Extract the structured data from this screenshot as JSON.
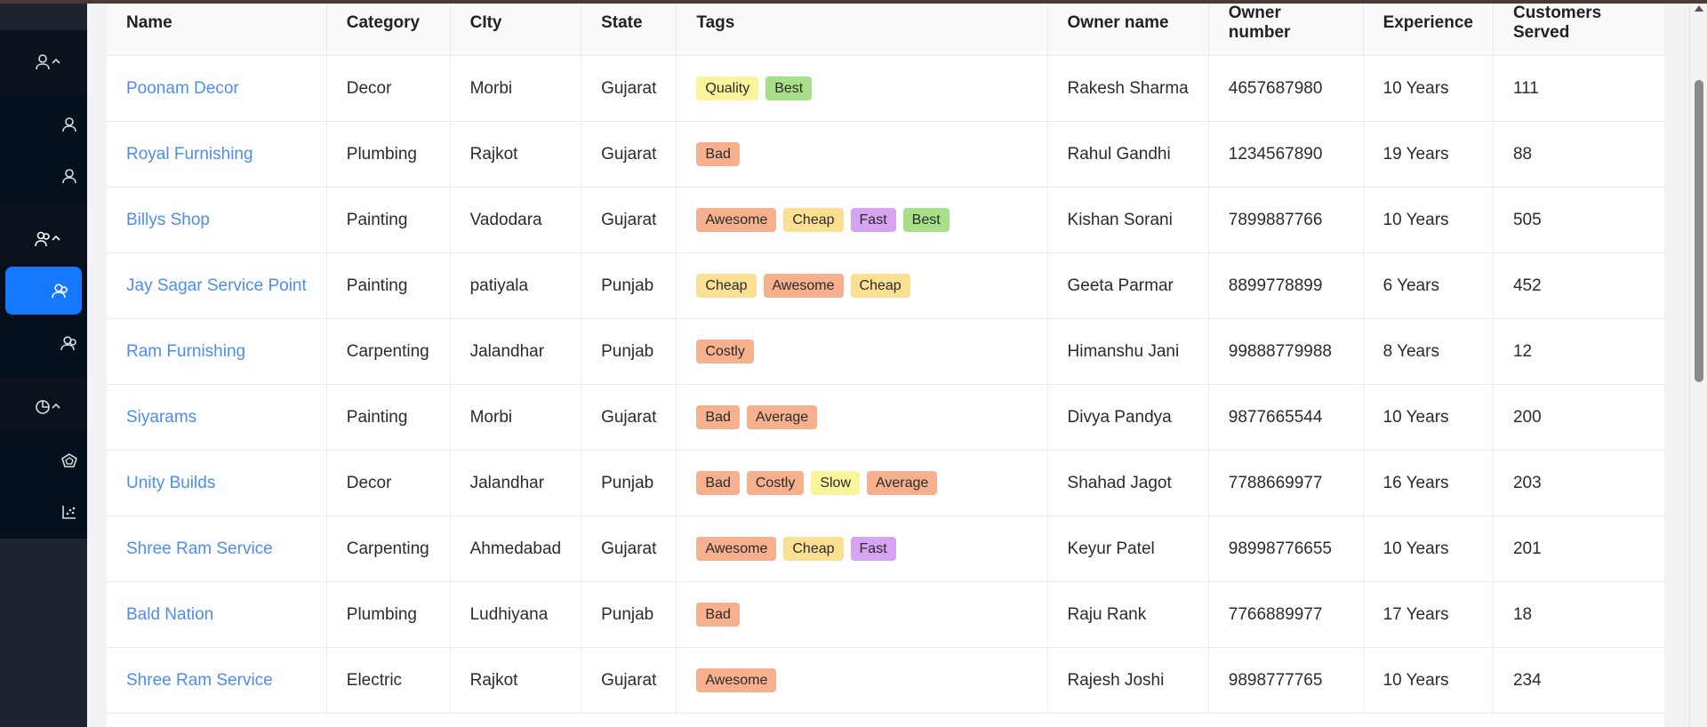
{
  "sidebar": {
    "items": [
      {
        "icon": "users-group-icon"
      },
      {
        "icon": "user-icon"
      },
      {
        "icon": "user-icon"
      },
      {
        "icon": "team-icon"
      },
      {
        "icon": "team-icon",
        "active": true
      },
      {
        "icon": "team-icon"
      },
      {
        "icon": "pie-chart-icon"
      },
      {
        "icon": "dashboard-icon"
      },
      {
        "icon": "scatter-chart-icon"
      }
    ]
  },
  "table": {
    "headers": [
      "Name",
      "Category",
      "CIty",
      "State",
      "Tags",
      "Owner name",
      "Owner number",
      "Experience",
      "Customers Served"
    ],
    "rows": [
      {
        "name": "Poonam Decor",
        "category": "Decor",
        "city": "Morbi",
        "state": "Gujarat",
        "tags": [
          "Quality",
          "Best"
        ],
        "owner": "Rakesh Sharma",
        "number": "4657687980",
        "experience": "10 Years",
        "served": "111"
      },
      {
        "name": "Royal Furnishing",
        "category": "Plumbing",
        "city": "Rajkot",
        "state": "Gujarat",
        "tags": [
          "Bad"
        ],
        "owner": "Rahul Gandhi",
        "number": "1234567890",
        "experience": "19 Years",
        "served": "88"
      },
      {
        "name": "Billys Shop",
        "category": "Painting",
        "city": "Vadodara",
        "state": "Gujarat",
        "tags": [
          "Awesome",
          "Cheap",
          "Fast",
          "Best"
        ],
        "owner": "Kishan Sorani",
        "number": "7899887766",
        "experience": "10 Years",
        "served": "505"
      },
      {
        "name": "Jay Sagar Service Point",
        "category": "Painting",
        "city": "patiyala",
        "state": "Punjab",
        "tags": [
          "Cheap",
          "Awesome",
          "Cheap"
        ],
        "owner": "Geeta Parmar",
        "number": "8899778899",
        "experience": "6 Years",
        "served": "452"
      },
      {
        "name": "Ram Furnishing",
        "category": "Carpenting",
        "city": "Jalandhar",
        "state": "Punjab",
        "tags": [
          "Costly"
        ],
        "owner": "Himanshu Jani",
        "number": "99888779988",
        "experience": "8 Years",
        "served": "12"
      },
      {
        "name": "Siyarams",
        "category": "Painting",
        "city": "Morbi",
        "state": "Gujarat",
        "tags": [
          "Bad",
          "Average"
        ],
        "owner": "Divya Pandya",
        "number": "9877665544",
        "experience": "10 Years",
        "served": "200"
      },
      {
        "name": "Unity Builds",
        "category": "Decor",
        "city": "Jalandhar",
        "state": "Punjab",
        "tags": [
          "Bad",
          "Costly",
          "Slow",
          "Average"
        ],
        "owner": "Shahad Jagot",
        "number": "7788669977",
        "experience": "16 Years",
        "served": "203"
      },
      {
        "name": "Shree Ram Service",
        "category": "Carpenting",
        "city": "Ahmedabad",
        "state": "Gujarat",
        "tags": [
          "Awesome",
          "Cheap",
          "Fast"
        ],
        "owner": "Keyur Patel",
        "number": "98998776655",
        "experience": "10 Years",
        "served": "201"
      },
      {
        "name": "Bald Nation",
        "category": "Plumbing",
        "city": "Ludhiyana",
        "state": "Punjab",
        "tags": [
          "Bad"
        ],
        "owner": "Raju Rank",
        "number": "7766889977",
        "experience": "17 Years",
        "served": "18"
      },
      {
        "name": "Shree Ram Service",
        "category": "Electric",
        "city": "Rajkot",
        "state": "Gujarat",
        "tags": [
          "Awesome"
        ],
        "owner": "Rajesh Joshi",
        "number": "9898777765",
        "experience": "10 Years",
        "served": "234"
      }
    ]
  },
  "colors": {
    "sidebar_bg": "#1c2430",
    "accent": "#1677ff",
    "link": "#4b8ef0"
  }
}
